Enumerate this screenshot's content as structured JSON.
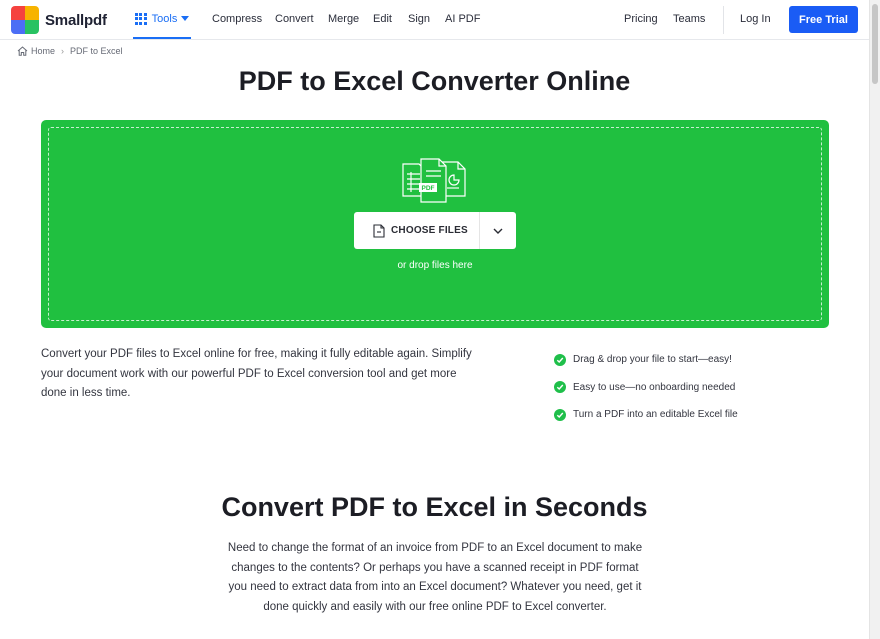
{
  "brand": {
    "name": "Smallpdf",
    "logo_colors": [
      "#f5423f",
      "#f7b300",
      "#28c262",
      "#4c6ef5"
    ]
  },
  "nav": {
    "tools_label": "Tools",
    "links": [
      "Compress",
      "Convert",
      "Merge",
      "Edit",
      "Sign",
      "AI PDF"
    ],
    "right_links": [
      "Pricing",
      "Teams"
    ],
    "login_label": "Log In",
    "trial_label": "Free Trial",
    "accent_color": "#1a5cf5"
  },
  "breadcrumb": {
    "home": "Home",
    "current": "PDF to Excel"
  },
  "hero": {
    "title": "PDF to Excel Converter Online"
  },
  "dropzone": {
    "button_label": "CHOOSE FILES",
    "drop_hint": "or drop files here",
    "illustration_badge": "PDF",
    "bg_color": "#20c040"
  },
  "intro": {
    "description": "Convert your PDF files to Excel online for free, making it fully editable again. Simplify your document work with our powerful PDF to Excel conversion tool and get more done in less time.",
    "features": [
      "Drag & drop your file to start—easy!",
      "Easy to use—no onboarding needed",
      "Turn a PDF into an editable Excel file"
    ]
  },
  "section": {
    "title": "Convert PDF to Excel in Seconds",
    "body": "Need to change the format of an invoice from PDF to an Excel document to make changes to the contents? Or perhaps you have a scanned receipt in PDF format you need to extract data from into an Excel document? Whatever you need, get it done quickly and easily with our free online PDF to Excel converter."
  }
}
